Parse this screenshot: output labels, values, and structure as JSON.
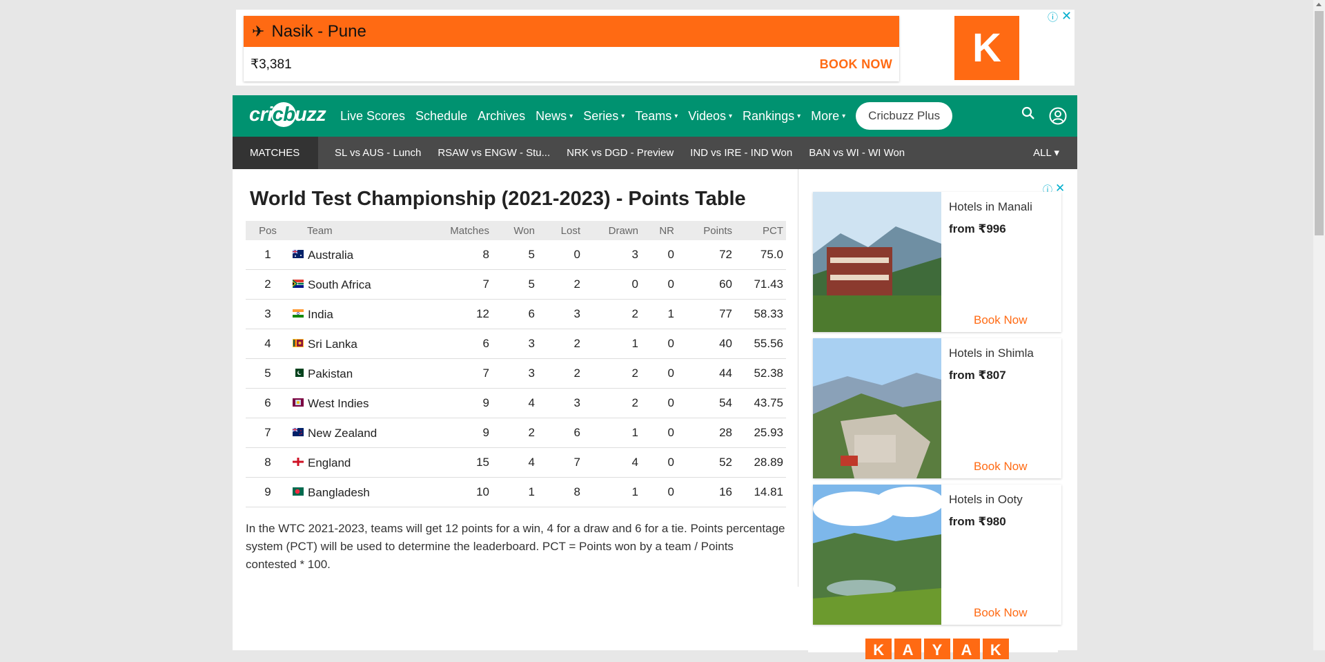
{
  "top_ad": {
    "route": "Nasik - Pune",
    "price": "₹3,381",
    "cta": "BOOK NOW",
    "logo_letter": "K",
    "info_icon": "ⓘ",
    "close_icon": "✕"
  },
  "nav": {
    "logo": {
      "pre": "cri",
      "ring": "cb",
      "post": "uzz"
    },
    "items": [
      {
        "label": "Live Scores",
        "caret": ""
      },
      {
        "label": "Schedule",
        "caret": ""
      },
      {
        "label": "Archives",
        "caret": ""
      },
      {
        "label": "News",
        "caret": "▾"
      },
      {
        "label": "Series",
        "caret": "▾"
      },
      {
        "label": "Teams",
        "caret": "▾"
      },
      {
        "label": "Videos",
        "caret": "▾"
      },
      {
        "label": "Rankings",
        "caret": "▾"
      },
      {
        "label": "More",
        "caret": "▾"
      }
    ],
    "plus": "Cricbuzz Plus"
  },
  "matchbar": {
    "label": "MATCHES",
    "matches": [
      "SL vs AUS - Lunch",
      "RSAW vs ENGW - Stu...",
      "NRK vs DGD - Preview",
      "IND vs IRE - IND Won",
      "BAN vs WI - WI Won"
    ],
    "all": "ALL ▾"
  },
  "page": {
    "title": "World Test Championship (2021-2023) - Points Table",
    "headers": [
      "Pos",
      "Team",
      "Matches",
      "Won",
      "Lost",
      "Drawn",
      "NR",
      "Points",
      "PCT"
    ],
    "rows": [
      {
        "pos": "1",
        "team": "Australia",
        "flag": "aus",
        "matches": "8",
        "won": "5",
        "lost": "0",
        "drawn": "3",
        "nr": "0",
        "points": "72",
        "pct": "75.0"
      },
      {
        "pos": "2",
        "team": "South Africa",
        "flag": "sa",
        "matches": "7",
        "won": "5",
        "lost": "2",
        "drawn": "0",
        "nr": "0",
        "points": "60",
        "pct": "71.43"
      },
      {
        "pos": "3",
        "team": "India",
        "flag": "ind",
        "matches": "12",
        "won": "6",
        "lost": "3",
        "drawn": "2",
        "nr": "1",
        "points": "77",
        "pct": "58.33"
      },
      {
        "pos": "4",
        "team": "Sri Lanka",
        "flag": "sl",
        "matches": "6",
        "won": "3",
        "lost": "2",
        "drawn": "1",
        "nr": "0",
        "points": "40",
        "pct": "55.56"
      },
      {
        "pos": "5",
        "team": "Pakistan",
        "flag": "pak",
        "matches": "7",
        "won": "3",
        "lost": "2",
        "drawn": "2",
        "nr": "0",
        "points": "44",
        "pct": "52.38"
      },
      {
        "pos": "6",
        "team": "West Indies",
        "flag": "wi",
        "matches": "9",
        "won": "4",
        "lost": "3",
        "drawn": "2",
        "nr": "0",
        "points": "54",
        "pct": "43.75"
      },
      {
        "pos": "7",
        "team": "New Zealand",
        "flag": "nz",
        "matches": "9",
        "won": "2",
        "lost": "6",
        "drawn": "1",
        "nr": "0",
        "points": "28",
        "pct": "25.93"
      },
      {
        "pos": "8",
        "team": "England",
        "flag": "eng",
        "matches": "15",
        "won": "4",
        "lost": "7",
        "drawn": "4",
        "nr": "0",
        "points": "52",
        "pct": "28.89"
      },
      {
        "pos": "9",
        "team": "Bangladesh",
        "flag": "ban",
        "matches": "10",
        "won": "1",
        "lost": "8",
        "drawn": "1",
        "nr": "0",
        "points": "16",
        "pct": "14.81"
      }
    ],
    "note": "In the WTC 2021-2023, teams will get 12 points for a win, 4 for a draw and 6 for a tie. Points percentage system (PCT) will be used to determine the leaderboard. PCT = Points won by a team / Points contested * 100."
  },
  "side_ads": {
    "info_icon": "ⓘ",
    "close_icon": "✕",
    "hotels": [
      {
        "title": "Hotels in Manali",
        "from": "from ₹996",
        "cta": "Book Now"
      },
      {
        "title": "Hotels in Shimla",
        "from": "from ₹807",
        "cta": "Book Now"
      },
      {
        "title": "Hotels in Ooty",
        "from": "from ₹980",
        "cta": "Book Now"
      }
    ],
    "kayak_letters": [
      "K",
      "A",
      "Y",
      "A",
      "K"
    ]
  },
  "colors": {
    "brand": "#009270",
    "ad_orange": "#ff6a13",
    "matchbar": "#4a4a4a"
  }
}
